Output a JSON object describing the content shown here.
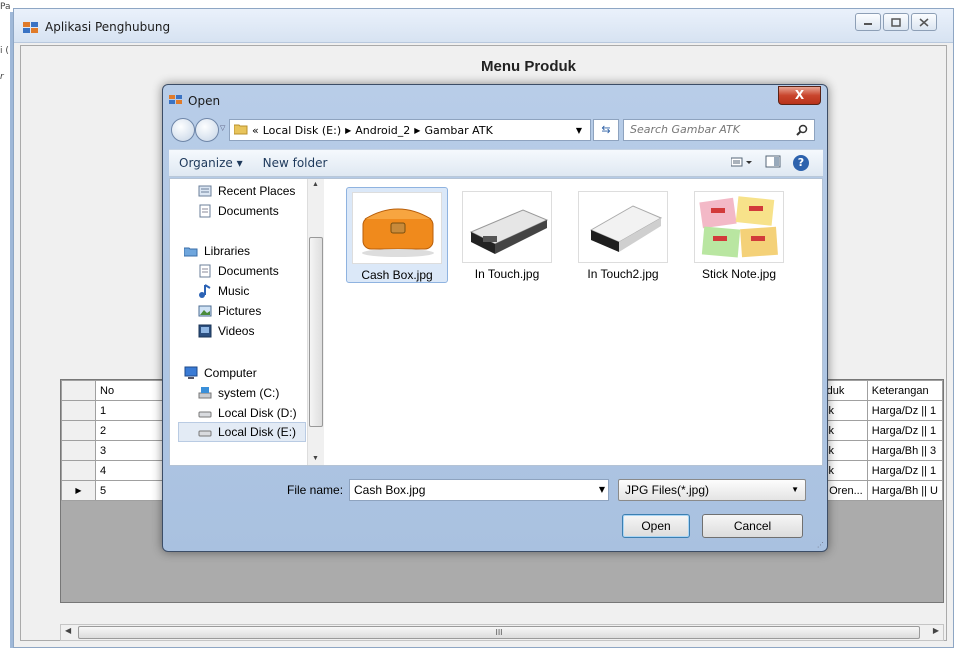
{
  "background": {
    "left_fragments": [
      "Pa",
      "i (",
      "r"
    ]
  },
  "window": {
    "title": "Aplikasi Penghubung",
    "heading": "Menu Produk",
    "controls": [
      "minimize-icon",
      "maximize-icon",
      "close-icon"
    ]
  },
  "grid": {
    "left_header": "No",
    "rows": [
      {
        "no": "1",
        "produk": "ick",
        "keterangan": "Harga/Dz || 1"
      },
      {
        "no": "2",
        "produk": "ick",
        "keterangan": "Harga/Dz || 1"
      },
      {
        "no": "3",
        "produk": "ick",
        "keterangan": "Harga/Bh || 3"
      },
      {
        "no": "4",
        "produk": "ick",
        "keterangan": "Harga/Dz || 1"
      },
      {
        "no": "5",
        "produk": "l, Oren...",
        "keterangan": "Harga/Bh || U"
      }
    ],
    "right_headers": [
      "oduk",
      "Keterangan"
    ],
    "current_row_marker": "▶",
    "scroll_grip": "III"
  },
  "dialog": {
    "title": "Open",
    "close_label": "X",
    "address": {
      "prefix": "«",
      "crumbs": [
        "Local Disk (E:)",
        "Android_2",
        "Gambar ATK"
      ]
    },
    "search_placeholder": "Search Gambar ATK",
    "toolbar": {
      "organize": "Organize ▾",
      "new_folder": "New folder",
      "help": "?"
    },
    "nav": [
      {
        "label": "Recent Places",
        "icon": "recent-places-icon"
      },
      {
        "label": "Documents",
        "icon": "document-icon"
      },
      {
        "label": "Libraries",
        "icon": "libraries-icon"
      },
      {
        "label": "Documents",
        "icon": "document-icon"
      },
      {
        "label": "Music",
        "icon": "music-icon"
      },
      {
        "label": "Pictures",
        "icon": "pictures-icon"
      },
      {
        "label": "Videos",
        "icon": "videos-icon"
      },
      {
        "label": "Computer",
        "icon": "computer-icon"
      },
      {
        "label": "system (C:)",
        "icon": "drive-icon"
      },
      {
        "label": "Local Disk (D:)",
        "icon": "drive-icon"
      },
      {
        "label": "Local Disk (E:)",
        "icon": "drive-icon"
      }
    ],
    "files": [
      {
        "name": "Cash Box.jpg",
        "selected": true
      },
      {
        "name": "In Touch.jpg",
        "selected": false
      },
      {
        "name": "In Touch2.jpg",
        "selected": false
      },
      {
        "name": "Stick Note.jpg",
        "selected": false
      }
    ],
    "file_name_label": "File name:",
    "file_name_value": "Cash Box.jpg",
    "file_type": "JPG Files(*.jpg)",
    "open_label": "Open",
    "cancel_label": "Cancel"
  },
  "colors": {
    "titlebar": "#d7e3f2",
    "dialog_frame": "#a9c1e0",
    "close_red": "#c9452d",
    "selection": "#dbe8f8"
  }
}
